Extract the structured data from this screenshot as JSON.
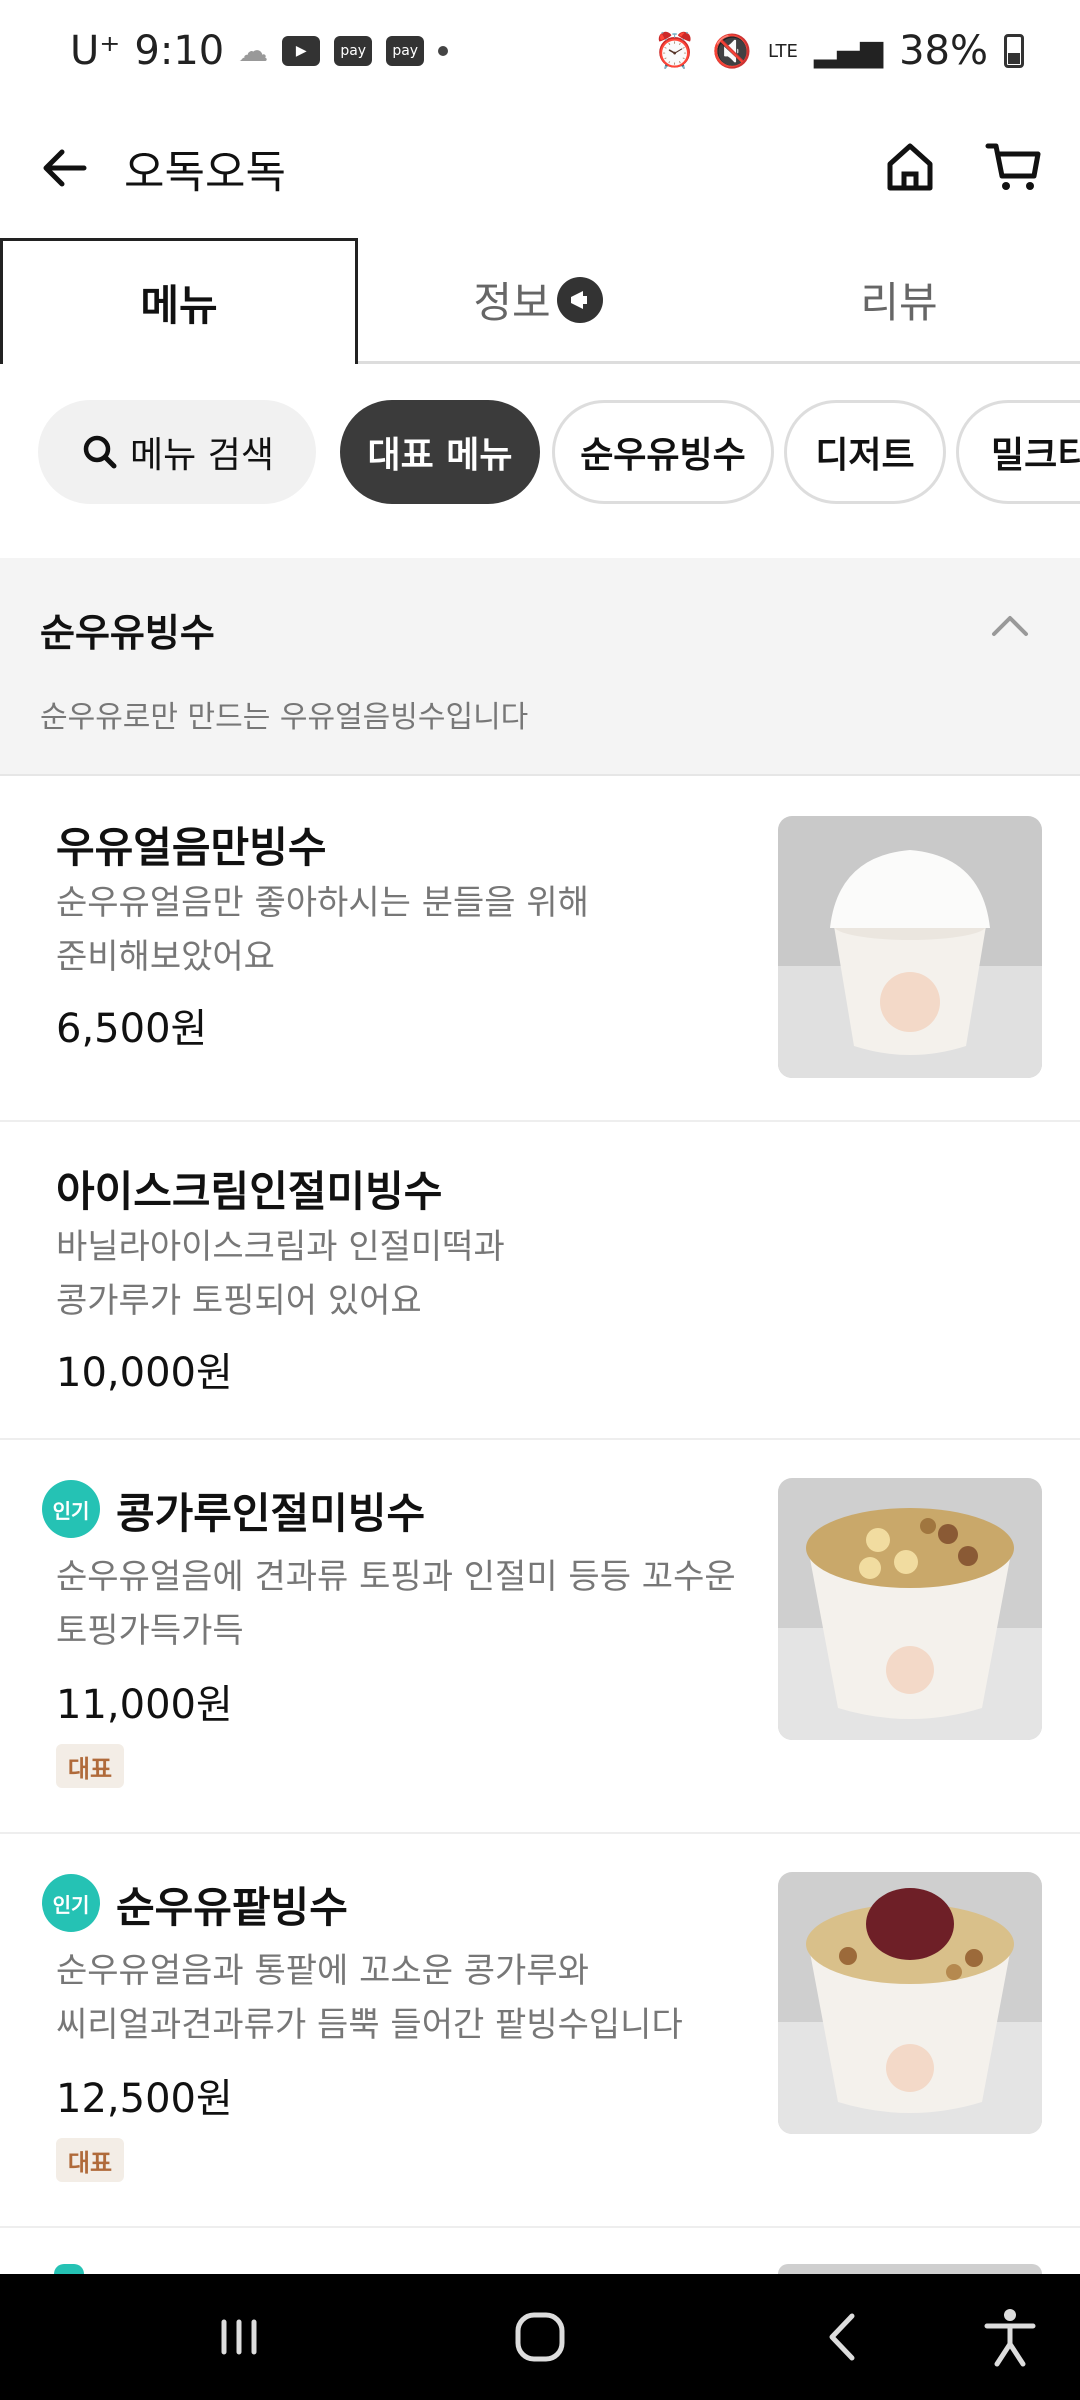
{
  "status": {
    "carrier": "U⁺",
    "time": "9:10",
    "signal_type": "LTE",
    "battery": "38%",
    "apps": [
      "pay",
      "pay"
    ]
  },
  "header": {
    "title": "오독오독"
  },
  "tabs": [
    {
      "label": "메뉴",
      "active": true
    },
    {
      "label": "정보",
      "active": false
    },
    {
      "label": "리뷰",
      "active": false
    }
  ],
  "chips": {
    "search_label": "메뉴 검색",
    "items": [
      "대표 메뉴",
      "순우유빙수",
      "디저트",
      "밀크티"
    ]
  },
  "section": {
    "title": "순우유빙수",
    "description": "순우유로만 만드는 우유얼음빙수입니다"
  },
  "menu": [
    {
      "name": "우유얼음만빙수",
      "desc1": "순우유얼음만 좋아하시는 분들을 위해",
      "desc2": "준비해보았어요",
      "price": "6,500원"
    },
    {
      "name": "아이스크림인절미빙수",
      "desc1": "바닐라아이스크림과 인절미떡과",
      "desc2": "콩가루가 토핑되어 있어요",
      "price": "10,000원"
    },
    {
      "badge": "인기",
      "name": "콩가루인절미빙수",
      "desc1": "순우유얼음에 견과류 토핑과 인절미 등등 꼬수운",
      "desc2": "토핑가득가득",
      "price": "11,000원",
      "tag": "대표"
    },
    {
      "badge": "인기",
      "name": "순우유팥빙수",
      "desc1": "순우유얼음과 통팥에 꼬소운 콩가루와",
      "desc2": "씨리얼과견과류가 듬뿍 들어간 팥빙수입니다",
      "price": "12,500원",
      "tag": "대표"
    }
  ],
  "colors": {
    "accent_badge": "#25c2b4",
    "active_chip": "#3b3b3b",
    "tag_bg": "#f3ede6",
    "tag_text": "#b06a3a"
  }
}
